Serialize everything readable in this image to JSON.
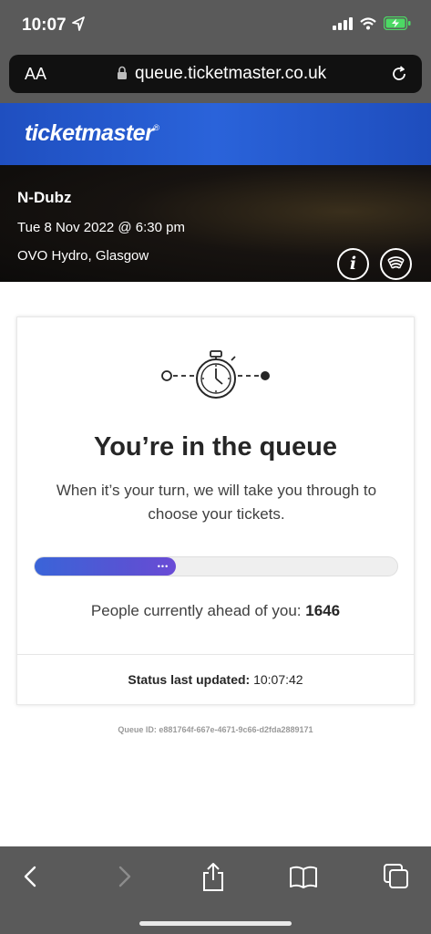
{
  "status_bar": {
    "time": "10:07",
    "battery_color": "#4cd964"
  },
  "url_bar": {
    "text_size_label": "AA",
    "url": "queue.ticketmaster.co.uk"
  },
  "brand": {
    "logo_text": "ticketmaster",
    "registered": "®",
    "color": "#2461d8"
  },
  "event": {
    "name": "N-Dubz",
    "date": "Tue 8 Nov 2022 @ 6:30 pm",
    "venue": "OVO Hydro, Glasgow",
    "info_button_label": "i"
  },
  "queue": {
    "title": "You’re in the queue",
    "subtitle": "When it’s your turn, we will take you through to choose your tickets.",
    "progress_fraction": 0.39,
    "ahead_label": "People currently ahead of you:",
    "ahead_count": "1646",
    "status_label": "Status last updated:",
    "status_time": "10:07:42",
    "queue_id": "Queue ID: e881764f-667e-4671-9c66-d2fda2889171"
  },
  "toolbar": {
    "icons": [
      "back-icon",
      "forward-icon",
      "share-icon",
      "bookmarks-icon",
      "tabs-icon"
    ]
  }
}
